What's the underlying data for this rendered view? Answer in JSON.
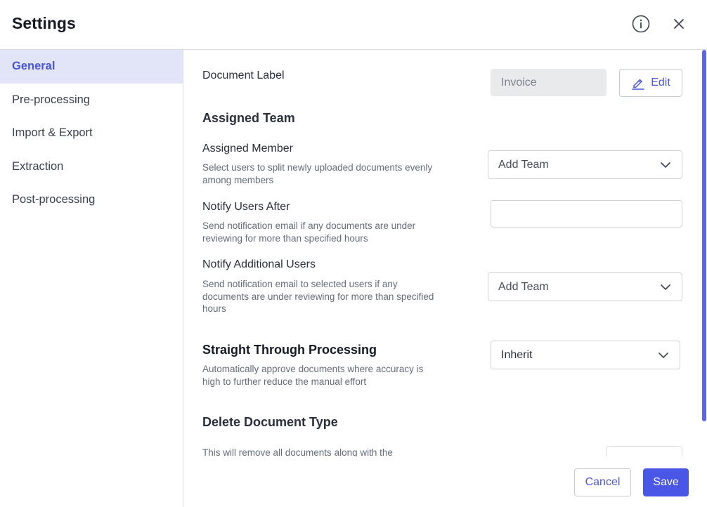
{
  "header": {
    "title": "Settings",
    "info_icon": "info-circle-icon",
    "close_icon": "close-icon"
  },
  "sidebar": {
    "items": [
      {
        "label": "General",
        "active": true
      },
      {
        "label": "Pre-processing",
        "active": false
      },
      {
        "label": "Import & Export",
        "active": false
      },
      {
        "label": "Extraction",
        "active": false
      },
      {
        "label": "Post-processing",
        "active": false
      }
    ]
  },
  "general": {
    "document_label": {
      "label": "Document Label",
      "value": "Invoice",
      "edit_label": "Edit",
      "edit_icon": "pencil-icon"
    },
    "assigned_team": {
      "heading": "Assigned Team",
      "assigned_member": {
        "label": "Assigned Member",
        "description": "Select users to split newly uploaded documents evenly among members",
        "placeholder": "Add Team"
      },
      "notify_after": {
        "label": "Notify Users After",
        "description": "Send notification email if any documents are under reviewing for more than specified hours",
        "value": ""
      },
      "notify_additional": {
        "label": "Notify Additional Users",
        "description": "Send notification email to selected users if any documents are under reviewing for more than specified hours",
        "placeholder": "Add Team"
      }
    },
    "stp": {
      "heading": "Straight Through Processing",
      "description": "Automatically approve documents where accuracy is high to further reduce the manual effort",
      "value": "Inherit"
    },
    "delete": {
      "heading": "Delete Document Type",
      "description": "This will remove all documents along with the"
    }
  },
  "footer": {
    "cancel_label": "Cancel",
    "save_label": "Save"
  },
  "colors": {
    "accent": "#4a56e6",
    "active_bg": "#e2e5f7",
    "disabled_bg": "#e9eaec"
  }
}
